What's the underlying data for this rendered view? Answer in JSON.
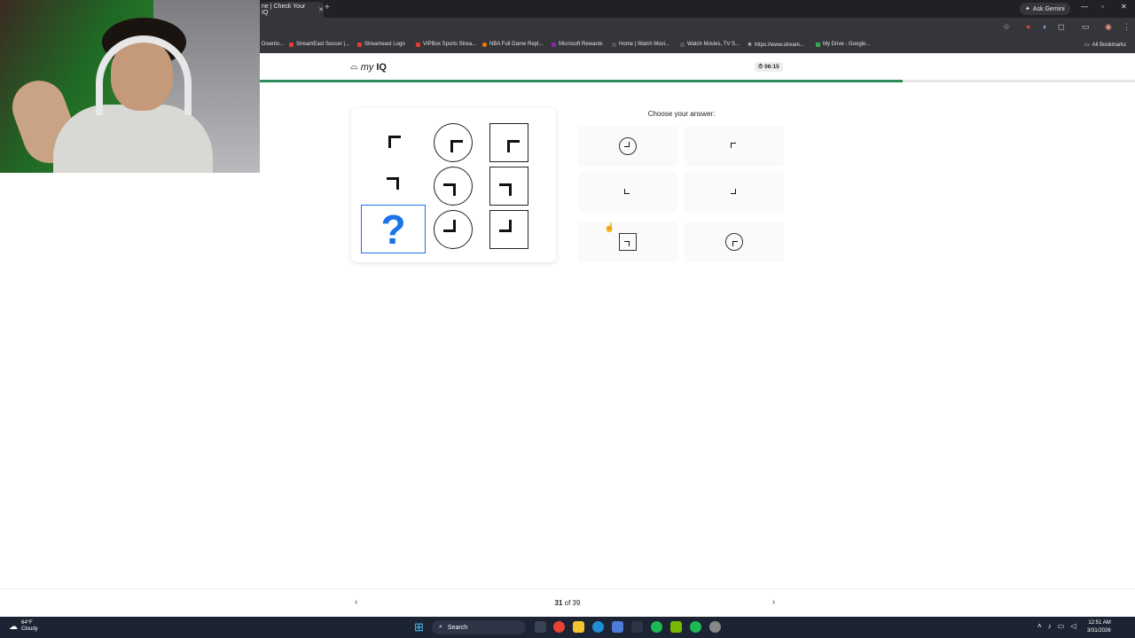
{
  "browser": {
    "tab_title": "ne | Check Your IQ",
    "tab_close": "✕",
    "new_tab": "+",
    "gemini_label": "Ask Gemini",
    "bookmarks": [
      {
        "label": "Downlo...",
        "color": "#888888"
      },
      {
        "label": "StreamEast Soccer |...",
        "color": "#e53935"
      },
      {
        "label": "Streameast Logo",
        "color": "#e53935"
      },
      {
        "label": "VIPBox Sports Strea...",
        "color": "#e53935"
      },
      {
        "label": "NBA Full Game Repl...",
        "color": "#f57c00"
      },
      {
        "label": "Microsoft Rewards",
        "color": "#8e24aa"
      },
      {
        "label": "Home | Watch Movi...",
        "color": "#555555"
      },
      {
        "label": "Watch Movies, TV S...",
        "color": "#555555"
      },
      {
        "label": "https://www.stream...",
        "color": "#ffffff"
      },
      {
        "label": "My Drive - Google...",
        "color": "#34a853"
      }
    ],
    "all_bookmarks": "All Bookmarks"
  },
  "app": {
    "logo_prefix": "my",
    "logo_suffix": "IQ",
    "timer": "06:15",
    "progress_fraction": 0.735
  },
  "question": {
    "placeholder": "?",
    "choose_label": "Choose your answer:"
  },
  "pager": {
    "current": "31",
    "of_text": " of 39",
    "prev": "‹",
    "next": "›"
  },
  "taskbar": {
    "temperature": "64°F",
    "condition": "Cloudy",
    "search_label": "Search",
    "time": "12:51 AM",
    "date": "3/31/2026"
  }
}
